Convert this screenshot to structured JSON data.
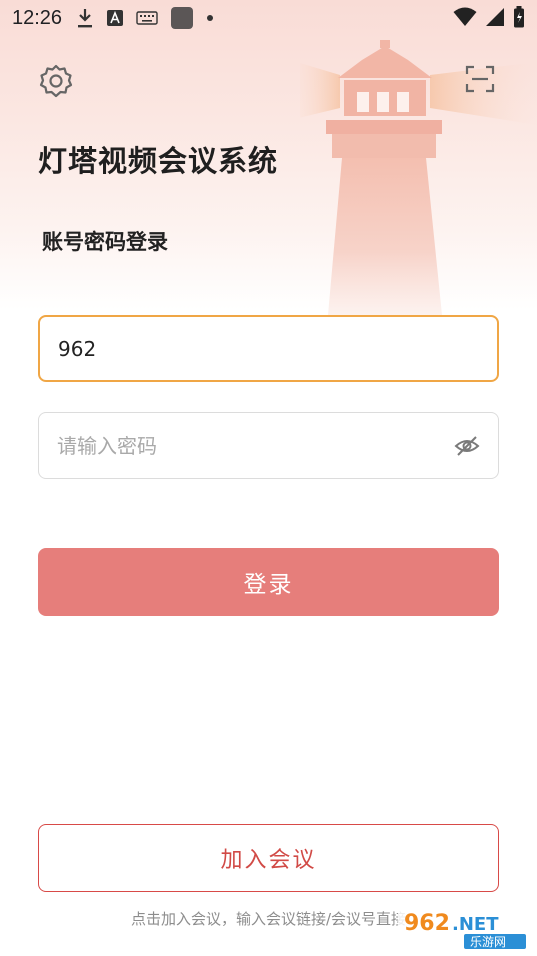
{
  "status_bar": {
    "time": "12:26",
    "icons": [
      "download-icon",
      "text-a-icon",
      "keyboard-icon",
      "app-square-icon",
      "dot-icon",
      "wifi-icon",
      "signal-icon",
      "battery-icon"
    ]
  },
  "header": {
    "settings_icon": "gear-icon",
    "scan_icon": "scan-icon",
    "app_title": "灯塔视频会议系统",
    "login_mode": "账号密码登录"
  },
  "form": {
    "account_value": "962",
    "password_placeholder": "请输入密码",
    "password_toggle_icon": "eye-off-icon",
    "login_label": "登录"
  },
  "footer": {
    "join_label": "加入会议",
    "hint": "点击加入会议，输入会议链接/会议号直接"
  },
  "watermark": {
    "brand": "962.NET",
    "sub": "乐游网"
  },
  "colors": {
    "accent_border": "#f0a645",
    "login_button": "#e67e7b",
    "join_border": "#d84a47"
  }
}
